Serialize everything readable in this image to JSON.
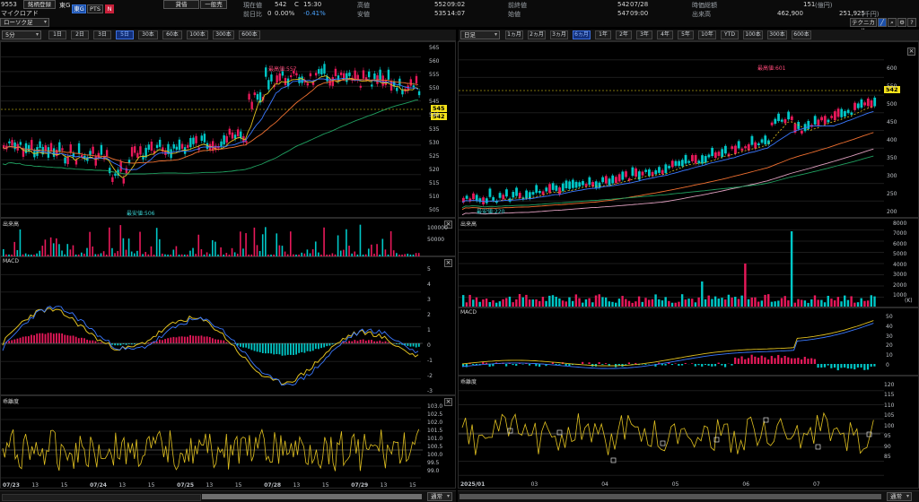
{
  "header": {
    "code": "9553",
    "name": "マイクロアド",
    "search_label": "銘柄登録",
    "market": "東G",
    "pts_label": "PTS",
    "mode_combo": "ローソク足",
    "lending_label": "貸借",
    "general_label": "一般売",
    "current_price_label": "現在値",
    "current_price": "542",
    "c_label": "C",
    "current_time": "15:30",
    "change_label": "前日比",
    "change_value": "0",
    "change_pct": "0.00%",
    "change_pct2": "-0.41%",
    "high_label": "高値",
    "high_value": "552",
    "high_time": "09:02",
    "low_label": "安値",
    "low_value": "535",
    "low_time": "14:07",
    "prev_label": "前終値",
    "prev_value": "542",
    "prev_date": "07/28",
    "open_label": "始値",
    "open_value": "547",
    "open_time": "09:00",
    "mcap_label": "時価総額",
    "mcap_value": "151",
    "mcap_unit": "(億円)",
    "volume_label": "出来高",
    "volume_value": "462,900",
    "turnover_value": "251,925",
    "turnover_unit": "(千円)",
    "technical_label": "テクニカル"
  },
  "left_toolbar": {
    "interval": "5分",
    "ranges": [
      "1日",
      "2日",
      "3日",
      "5日",
      "30本",
      "60本",
      "100本",
      "300本",
      "600本"
    ],
    "active": "5日"
  },
  "right_toolbar": {
    "interval": "日足",
    "ranges": [
      "1ヵ月",
      "2ヵ月",
      "3ヵ月",
      "6ヵ月",
      "1年",
      "2年",
      "3年",
      "4年",
      "5年",
      "10年",
      "YTD",
      "100本",
      "300本",
      "600本"
    ],
    "active": "6ヵ月"
  },
  "left_chart": {
    "price_axis": [
      "565",
      "560",
      "555",
      "550",
      "545",
      "540",
      "535",
      "530",
      "525",
      "520",
      "515",
      "510",
      "505"
    ],
    "max_label": "最高値:557",
    "min_label": "最安値:506",
    "price_tag": "542",
    "price_tag2": "545",
    "volume_label": "出来高",
    "volume_axis": [
      "100000",
      "50000"
    ],
    "macd_label": "MACD",
    "macd_axis": [
      "5",
      "4",
      "3",
      "2",
      "1",
      "0",
      "-1",
      "-2",
      "-3"
    ],
    "rci_label": "乖離度",
    "rci_axis": [
      "103.0",
      "102.5",
      "102.0",
      "101.5",
      "101.0",
      "100.5",
      "100.0",
      "99.5",
      "99.0"
    ],
    "x_labels": [
      "07/23",
      "13",
      "15",
      "07/24",
      "13",
      "15",
      "07/25",
      "13",
      "15",
      "07/28",
      "13",
      "15",
      "07/29",
      "13",
      "15"
    ]
  },
  "right_chart": {
    "price_axis": [
      "600",
      "550",
      "500",
      "450",
      "400",
      "350",
      "300",
      "250",
      "200"
    ],
    "max_label": "最高値:601",
    "min_label": "最安値:220",
    "price_tag": "542",
    "volume_label": "出来高",
    "volume_axis": [
      "8000",
      "7000",
      "6000",
      "5000",
      "4000",
      "3000",
      "2000",
      "1000"
    ],
    "volume_unit": "(K)",
    "macd_label": "MACD",
    "macd_axis": [
      "50",
      "40",
      "30",
      "20",
      "10",
      "0"
    ],
    "rci_label": "乖離度",
    "rci_axis": [
      "120",
      "115",
      "110",
      "105",
      "100",
      "95",
      "90",
      "85"
    ],
    "x_labels": [
      "2025/01",
      "03",
      "04",
      "05",
      "06",
      "07"
    ]
  },
  "footer": {
    "left_combo": "通常",
    "right_combo": "通常"
  },
  "colors": {
    "up": "#00c8c8",
    "down": "#e8195a",
    "ma_short": "#e0c020",
    "ma_mid": "#3a78ff",
    "ma_long": "#f07030",
    "ma_xlong": "#20a060",
    "highlight": "#f5e21a"
  }
}
